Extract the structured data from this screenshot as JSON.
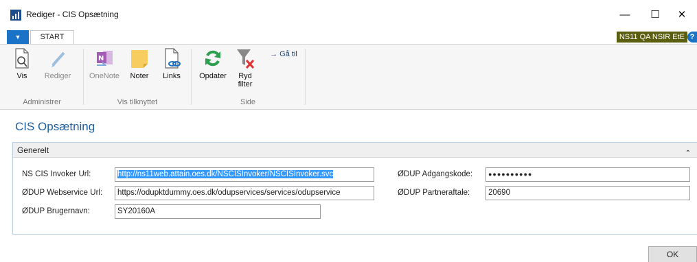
{
  "window": {
    "title": "Rediger - CIS Opsætning",
    "minimize": "—",
    "maximize": "☐",
    "close": "✕"
  },
  "ribbon": {
    "file_tab": "▼",
    "start_tab": "START",
    "company": "NS11 QA NSIR EtE",
    "help": "?",
    "buttons": {
      "vis": "Vis",
      "rediger": "Rediger",
      "onenote": "OneNote",
      "noter": "Noter",
      "links": "Links",
      "opdater": "Opdater",
      "ryd_filter_1": "Ryd",
      "ryd_filter_2": "filter",
      "gaa_til": "→ Gå til"
    },
    "groups": {
      "administrer": "Administrer",
      "vis_tilknyttet": "Vis tilknyttet",
      "side": "Side"
    }
  },
  "page": {
    "title": "CIS Opsætning",
    "fasttab": "Generelt",
    "collapse": "⌃"
  },
  "fields": {
    "ns_cis_invoker_url": {
      "label": "NS CIS Invoker Url:",
      "value": "http://ns11web.attain.oes.dk/NSCISInvoker/NSCISInvoker.svc"
    },
    "odup_webservice_url": {
      "label": "ØDUP Webservice Url:",
      "value": "https://odupktdummy.oes.dk/odupservices/services/odupservice"
    },
    "odup_brugernavn": {
      "label": "ØDUP Brugernavn:",
      "value": "SY20160A"
    },
    "odup_adgangskode": {
      "label": "ØDUP Adgangskode:",
      "value": "●●●●●●●●●●"
    },
    "odup_partneraftale": {
      "label": "ØDUP Partneraftale:",
      "value": "20690"
    }
  },
  "footer": {
    "ok": "OK"
  }
}
